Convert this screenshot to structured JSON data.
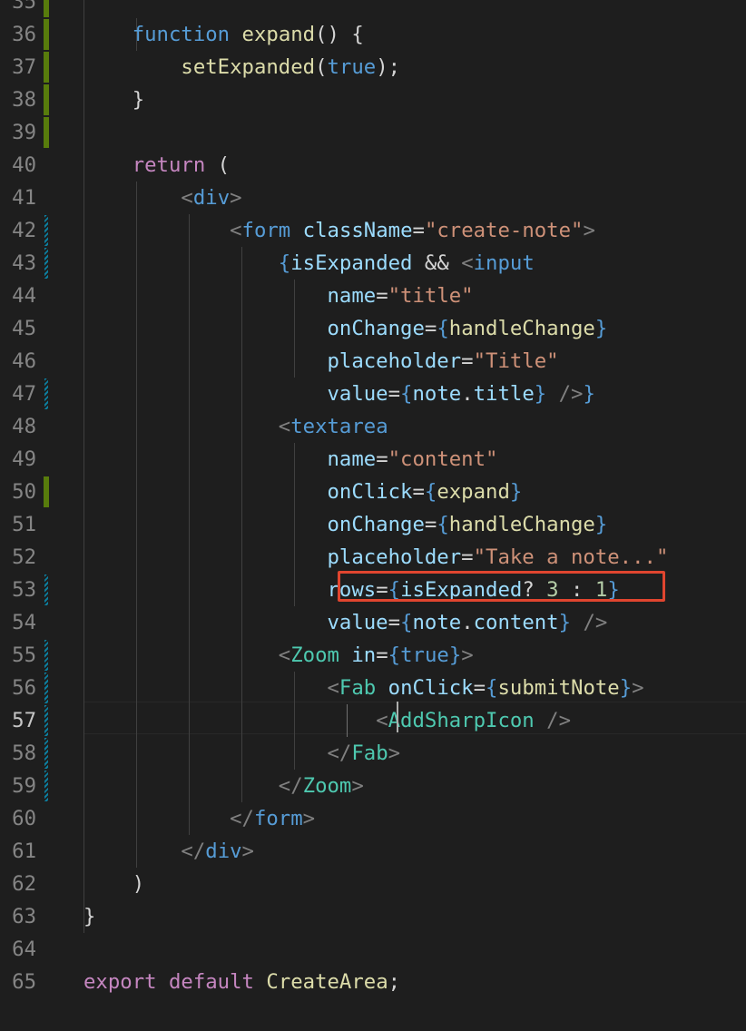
{
  "editor": {
    "language": "javascript-jsx",
    "active_line": "57",
    "highlighted_text": "rows={isExpanded? 3 : 1}",
    "highlight_color": "#e0452f",
    "lines": [
      {
        "n": "35",
        "gutter": "added",
        "tokens": []
      },
      {
        "n": "36",
        "gutter": "added",
        "tokens": [
          [
            "    ",
            "pun"
          ],
          [
            "function",
            "kw"
          ],
          [
            " ",
            "pun"
          ],
          [
            "expand",
            "fn"
          ],
          [
            "() {",
            "pun"
          ]
        ]
      },
      {
        "n": "37",
        "gutter": "added",
        "tokens": [
          [
            "        ",
            "pun"
          ],
          [
            "setExpanded",
            "fn"
          ],
          [
            "(",
            "pun"
          ],
          [
            "true",
            "kw"
          ],
          [
            ");",
            "pun"
          ]
        ]
      },
      {
        "n": "38",
        "gutter": "added",
        "tokens": [
          [
            "    ",
            "pun"
          ],
          [
            "}",
            "pun"
          ]
        ]
      },
      {
        "n": "39",
        "gutter": "added",
        "tokens": []
      },
      {
        "n": "40",
        "gutter": "",
        "tokens": [
          [
            "    ",
            "pun"
          ],
          [
            "return",
            "ctl"
          ],
          [
            " (",
            "pun"
          ]
        ]
      },
      {
        "n": "41",
        "gutter": "",
        "tokens": [
          [
            "        ",
            "pun"
          ],
          [
            "<",
            "brk"
          ],
          [
            "div",
            "tag"
          ],
          [
            ">",
            "brk"
          ]
        ]
      },
      {
        "n": "42",
        "gutter": "modified",
        "tokens": [
          [
            "            ",
            "pun"
          ],
          [
            "<",
            "brk"
          ],
          [
            "form",
            "tag"
          ],
          [
            " ",
            "pun"
          ],
          [
            "className",
            "attr"
          ],
          [
            "=",
            "pun"
          ],
          [
            "\"create-note\"",
            "str"
          ],
          [
            ">",
            "brk"
          ]
        ]
      },
      {
        "n": "43",
        "gutter": "modified",
        "tokens": [
          [
            "                ",
            "pun"
          ],
          [
            "{",
            "kw"
          ],
          [
            "isExpanded",
            "var"
          ],
          [
            " && ",
            "pun"
          ],
          [
            "<",
            "brk"
          ],
          [
            "input",
            "tag"
          ]
        ]
      },
      {
        "n": "44",
        "gutter": "",
        "tokens": [
          [
            "                    ",
            "pun"
          ],
          [
            "name",
            "attr"
          ],
          [
            "=",
            "pun"
          ],
          [
            "\"title\"",
            "str"
          ]
        ]
      },
      {
        "n": "45",
        "gutter": "",
        "tokens": [
          [
            "                    ",
            "pun"
          ],
          [
            "onChange",
            "attr"
          ],
          [
            "=",
            "pun"
          ],
          [
            "{",
            "kw"
          ],
          [
            "handleChange",
            "fn"
          ],
          [
            "}",
            "kw"
          ]
        ]
      },
      {
        "n": "46",
        "gutter": "",
        "tokens": [
          [
            "                    ",
            "pun"
          ],
          [
            "placeholder",
            "attr"
          ],
          [
            "=",
            "pun"
          ],
          [
            "\"Title\"",
            "str"
          ]
        ]
      },
      {
        "n": "47",
        "gutter": "modified",
        "tokens": [
          [
            "                    ",
            "pun"
          ],
          [
            "value",
            "attr"
          ],
          [
            "=",
            "pun"
          ],
          [
            "{",
            "kw"
          ],
          [
            "note",
            "var"
          ],
          [
            ".",
            "pun"
          ],
          [
            "title",
            "var"
          ],
          [
            "}",
            "kw"
          ],
          [
            " ",
            "pun"
          ],
          [
            "/>",
            "brk"
          ],
          [
            "}",
            "kw"
          ]
        ]
      },
      {
        "n": "48",
        "gutter": "",
        "tokens": [
          [
            "                ",
            "pun"
          ],
          [
            "<",
            "brk"
          ],
          [
            "textarea",
            "tag"
          ]
        ]
      },
      {
        "n": "49",
        "gutter": "",
        "tokens": [
          [
            "                    ",
            "pun"
          ],
          [
            "name",
            "attr"
          ],
          [
            "=",
            "pun"
          ],
          [
            "\"content\"",
            "str"
          ]
        ]
      },
      {
        "n": "50",
        "gutter": "added",
        "tokens": [
          [
            "                    ",
            "pun"
          ],
          [
            "onClick",
            "attr"
          ],
          [
            "=",
            "pun"
          ],
          [
            "{",
            "kw"
          ],
          [
            "expand",
            "fn"
          ],
          [
            "}",
            "kw"
          ]
        ]
      },
      {
        "n": "51",
        "gutter": "",
        "tokens": [
          [
            "                    ",
            "pun"
          ],
          [
            "onChange",
            "attr"
          ],
          [
            "=",
            "pun"
          ],
          [
            "{",
            "kw"
          ],
          [
            "handleChange",
            "fn"
          ],
          [
            "}",
            "kw"
          ]
        ]
      },
      {
        "n": "52",
        "gutter": "",
        "tokens": [
          [
            "                    ",
            "pun"
          ],
          [
            "placeholder",
            "attr"
          ],
          [
            "=",
            "pun"
          ],
          [
            "\"Take a note...\"",
            "str"
          ]
        ]
      },
      {
        "n": "53",
        "gutter": "modified",
        "tokens": [
          [
            "                    ",
            "pun"
          ],
          [
            "rows",
            "attr"
          ],
          [
            "=",
            "pun"
          ],
          [
            "{",
            "kw"
          ],
          [
            "isExpanded",
            "var"
          ],
          [
            "? ",
            "pun"
          ],
          [
            "3",
            "num"
          ],
          [
            " : ",
            "pun"
          ],
          [
            "1",
            "num"
          ],
          [
            "}",
            "kw"
          ]
        ]
      },
      {
        "n": "54",
        "gutter": "",
        "tokens": [
          [
            "                    ",
            "pun"
          ],
          [
            "value",
            "attr"
          ],
          [
            "=",
            "pun"
          ],
          [
            "{",
            "kw"
          ],
          [
            "note",
            "var"
          ],
          [
            ".",
            "pun"
          ],
          [
            "content",
            "var"
          ],
          [
            "}",
            "kw"
          ],
          [
            " ",
            "pun"
          ],
          [
            "/>",
            "brk"
          ]
        ]
      },
      {
        "n": "55",
        "gutter": "modified",
        "tokens": [
          [
            "                ",
            "pun"
          ],
          [
            "<",
            "brk"
          ],
          [
            "Zoom",
            "comp"
          ],
          [
            " ",
            "pun"
          ],
          [
            "in",
            "attr"
          ],
          [
            "=",
            "pun"
          ],
          [
            "{",
            "kw"
          ],
          [
            "true",
            "kw"
          ],
          [
            "}",
            "kw"
          ],
          [
            ">",
            "brk"
          ]
        ]
      },
      {
        "n": "56",
        "gutter": "modified",
        "tokens": [
          [
            "                    ",
            "pun"
          ],
          [
            "<",
            "brk"
          ],
          [
            "Fab",
            "comp"
          ],
          [
            " ",
            "pun"
          ],
          [
            "onClick",
            "attr"
          ],
          [
            "=",
            "pun"
          ],
          [
            "{",
            "kw"
          ],
          [
            "submitNote",
            "fn"
          ],
          [
            "}",
            "kw"
          ],
          [
            ">",
            "brk"
          ]
        ]
      },
      {
        "n": "57",
        "gutter": "modified",
        "tokens": [
          [
            "                        ",
            "pun"
          ],
          [
            "<",
            "brk"
          ],
          [
            "AddSharpIcon",
            "comp"
          ],
          [
            " ",
            "pun"
          ],
          [
            "/>",
            "brk"
          ]
        ]
      },
      {
        "n": "58",
        "gutter": "modified",
        "tokens": [
          [
            "                    ",
            "pun"
          ],
          [
            "</",
            "brk"
          ],
          [
            "Fab",
            "comp"
          ],
          [
            ">",
            "brk"
          ]
        ]
      },
      {
        "n": "59",
        "gutter": "modified",
        "tokens": [
          [
            "                ",
            "pun"
          ],
          [
            "</",
            "brk"
          ],
          [
            "Zoom",
            "comp"
          ],
          [
            ">",
            "brk"
          ]
        ]
      },
      {
        "n": "60",
        "gutter": "",
        "tokens": [
          [
            "            ",
            "pun"
          ],
          [
            "</",
            "brk"
          ],
          [
            "form",
            "tag"
          ],
          [
            ">",
            "brk"
          ]
        ]
      },
      {
        "n": "61",
        "gutter": "",
        "tokens": [
          [
            "        ",
            "pun"
          ],
          [
            "</",
            "brk"
          ],
          [
            "div",
            "tag"
          ],
          [
            ">",
            "brk"
          ]
        ]
      },
      {
        "n": "62",
        "gutter": "",
        "tokens": [
          [
            "    ",
            "pun"
          ],
          [
            ")",
            "pun"
          ]
        ]
      },
      {
        "n": "63",
        "gutter": "",
        "tokens": [
          [
            "}",
            "pun"
          ]
        ]
      },
      {
        "n": "64",
        "gutter": "",
        "tokens": []
      },
      {
        "n": "65",
        "gutter": "",
        "tokens": [
          [
            "export",
            "ctl"
          ],
          [
            " ",
            "pun"
          ],
          [
            "default",
            "ctl"
          ],
          [
            " ",
            "pun"
          ],
          [
            "CreateArea",
            "fn"
          ],
          [
            ";",
            "pun"
          ]
        ]
      }
    ]
  }
}
